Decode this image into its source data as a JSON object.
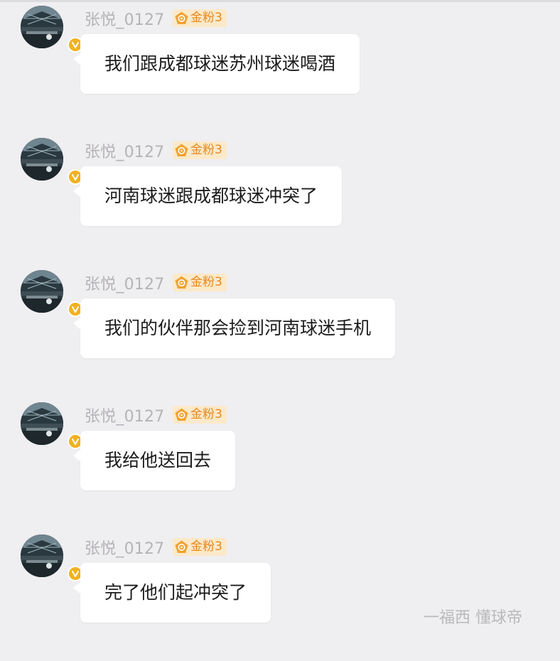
{
  "colors": {
    "background": "#efeef0",
    "bubble": "#ffffff",
    "username": "#b5b3b8",
    "fan_badge_bg": "#fbe9c9",
    "fan_badge_text": "#e6891f",
    "verified_badge": "#f2b11f"
  },
  "messages": [
    {
      "username": "张悦_0127",
      "badge": "金粉3",
      "text": "我们跟成都球迷苏州球迷喝酒"
    },
    {
      "username": "张悦_0127",
      "badge": "金粉3",
      "text": "河南球迷跟成都球迷冲突了"
    },
    {
      "username": "张悦_0127",
      "badge": "金粉3",
      "text": "我们的伙伴那会捡到河南球迷手机"
    },
    {
      "username": "张悦_0127",
      "badge": "金粉3",
      "text": "我给他送回去"
    },
    {
      "username": "张悦_0127",
      "badge": "金粉3",
      "text": "完了他们起冲突了"
    }
  ],
  "footer": {
    "watermark": "一福西   懂球帝"
  }
}
